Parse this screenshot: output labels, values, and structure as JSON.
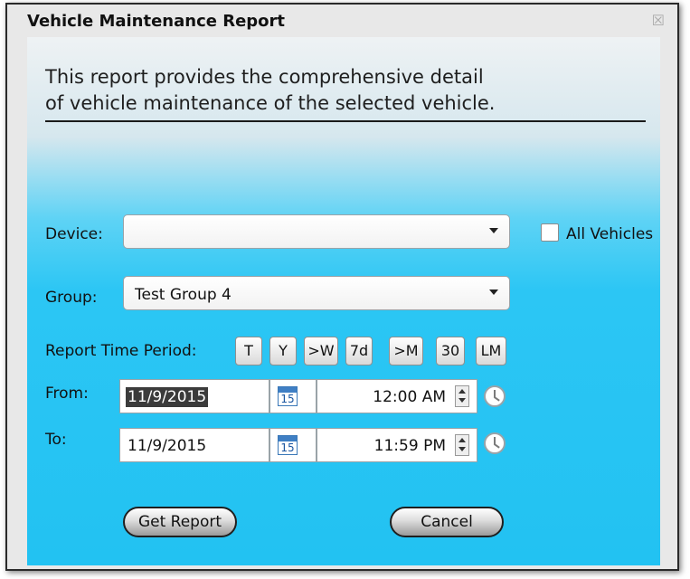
{
  "window": {
    "title": "Vehicle Maintenance Report",
    "close_glyph": "☒"
  },
  "description": {
    "line1": "This report provides the comprehensive detail",
    "line2": "of vehicle maintenance of the selected vehicle."
  },
  "device": {
    "label": "Device:",
    "value": ""
  },
  "all_vehicles": {
    "label": "All Vehicles",
    "checked": false
  },
  "group": {
    "label": "Group:",
    "value": "Test Group 4"
  },
  "period": {
    "label": "Report Time Period:",
    "buttons": [
      "T",
      "Y",
      ">W",
      "7d",
      ">M",
      "30",
      "LM"
    ]
  },
  "from": {
    "label": "From:",
    "date": "11/9/2015",
    "time": "12:00 AM",
    "calendar_day": "15"
  },
  "to": {
    "label": "To:",
    "date": "11/9/2015",
    "time": "11:59 PM",
    "calendar_day": "15"
  },
  "actions": {
    "get_report": "Get Report",
    "cancel": "Cancel"
  }
}
